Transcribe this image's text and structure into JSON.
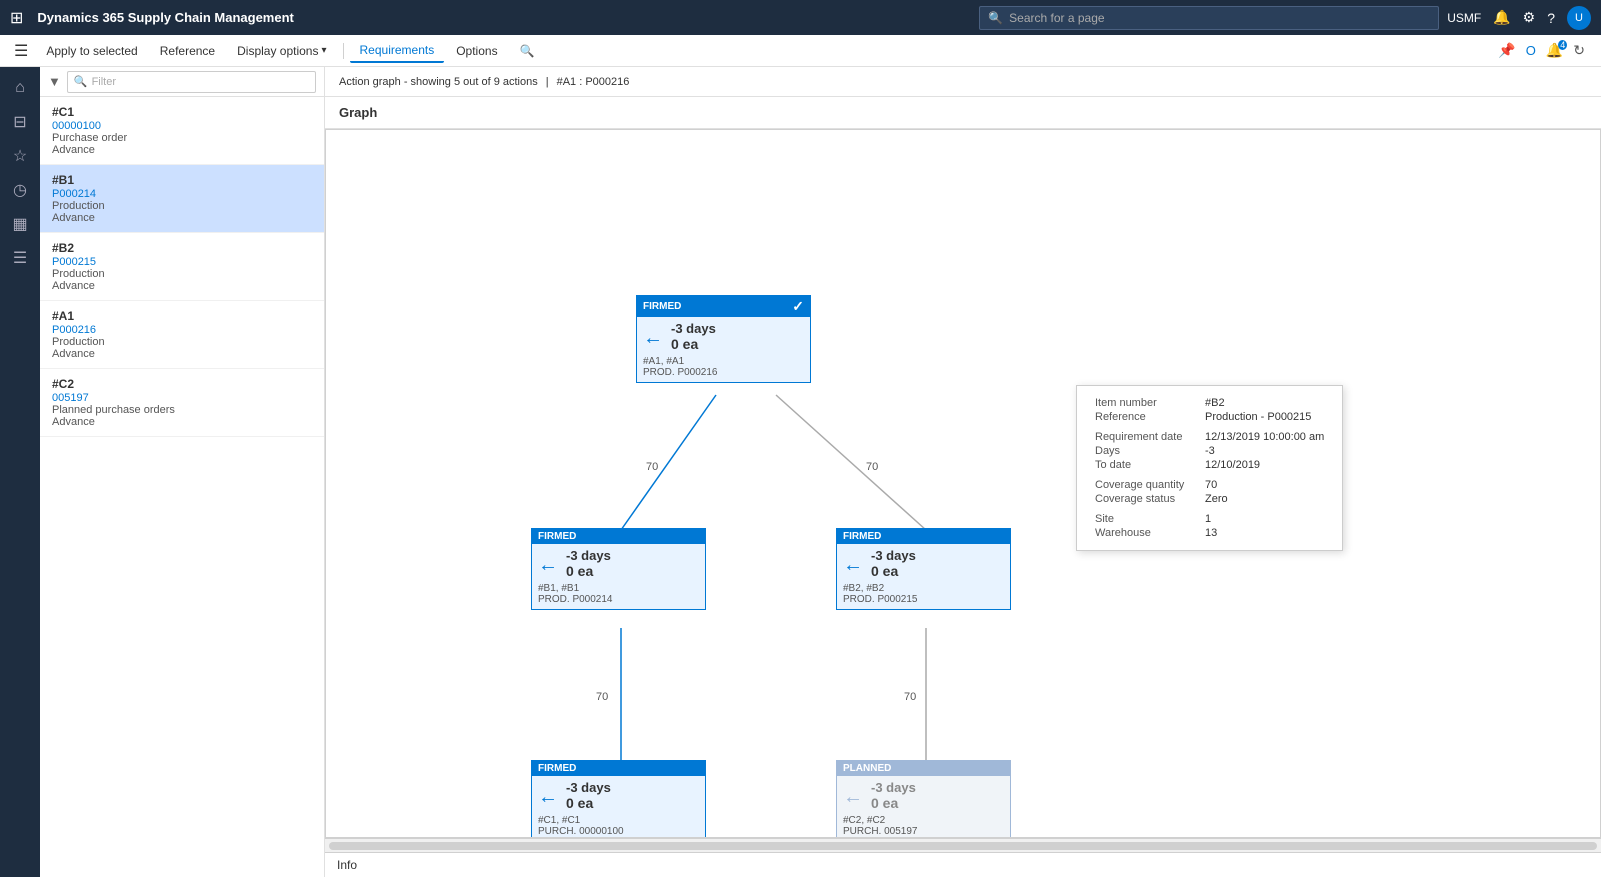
{
  "app": {
    "title": "Dynamics 365 Supply Chain Management",
    "waffle_icon": "⊞"
  },
  "topnav": {
    "search_placeholder": "Search for a page",
    "user": "USMF"
  },
  "action_bar": {
    "apply_to_selected": "Apply to selected",
    "reference": "Reference",
    "display_options": "Display options",
    "requirements": "Requirements",
    "options": "Options"
  },
  "graph_header": {
    "action_text": "Action graph - showing 5 out of 9 actions",
    "separator": "|",
    "ref": "#A1 : P000216"
  },
  "graph_section": {
    "label": "Graph"
  },
  "sidebar_items": [
    {
      "id": "#C1",
      "code": "00000100",
      "type": "Purchase order",
      "tag": "Advance",
      "active": false
    },
    {
      "id": "#B1",
      "code": "P000214",
      "type": "Production",
      "tag": "Advance",
      "active": true
    },
    {
      "id": "#B2",
      "code": "P000215",
      "type": "Production",
      "tag": "Advance",
      "active": false
    },
    {
      "id": "#A1",
      "code": "P000216",
      "type": "Production",
      "tag": "Advance",
      "active": false
    },
    {
      "id": "#C2",
      "code": "005197",
      "type": "Planned purchase orders",
      "tag": "Advance",
      "active": false
    }
  ],
  "nodes": {
    "top": {
      "status": "FIRMED",
      "days": "-3 days",
      "ea": "0 ea",
      "ref1": "#A1, #A1",
      "ref2": "PROD. P000216",
      "has_check": true
    },
    "mid_left": {
      "status": "FIRMED",
      "days": "-3 days",
      "ea": "0 ea",
      "ref1": "#B1, #B1",
      "ref2": "PROD. P000214",
      "has_check": false
    },
    "mid_right": {
      "status": "FIRMED",
      "days": "-3 days",
      "ea": "0 ea",
      "ref1": "#B2, #B2",
      "ref2": "PROD. P000215",
      "has_check": false
    },
    "bot_left": {
      "status": "FIRMED",
      "days": "-3 days",
      "ea": "0 ea",
      "ref1": "#C1, #C1",
      "ref2": "PURCH. 00000100",
      "has_check": false
    },
    "bot_right": {
      "status": "PLANNED",
      "days": "-3 days",
      "ea": "0 ea",
      "ref1": "#C2, #C2",
      "ref2": "PURCH. 005197",
      "has_check": false,
      "faded": true
    }
  },
  "edge_labels": {
    "top_to_mid_left": "70",
    "top_to_mid_right": "70",
    "mid_left_to_bot_left": "70",
    "mid_right_to_bot_right": "70"
  },
  "info_popup": {
    "item_number_label": "Item number",
    "item_number_value": "#B2",
    "reference_label": "Reference",
    "reference_value": "Production - P000215",
    "requirement_date_label": "Requirement date",
    "requirement_date_value": "12/13/2019 10:00:00 am",
    "days_label": "Days",
    "days_value": "-3",
    "to_date_label": "To date",
    "to_date_value": "12/10/2019",
    "coverage_quantity_label": "Coverage quantity",
    "coverage_quantity_value": "70",
    "coverage_status_label": "Coverage status",
    "coverage_status_value": "Zero",
    "site_label": "Site",
    "site_value": "1",
    "warehouse_label": "Warehouse",
    "warehouse_value": "13"
  },
  "bottom_bar": {
    "label": "Info"
  },
  "sidebar_nav": [
    {
      "icon": "⌂",
      "name": "home"
    },
    {
      "icon": "☆",
      "name": "favorites"
    },
    {
      "icon": "◷",
      "name": "recent"
    },
    {
      "icon": "▦",
      "name": "workspaces"
    },
    {
      "icon": "☰",
      "name": "modules"
    }
  ]
}
